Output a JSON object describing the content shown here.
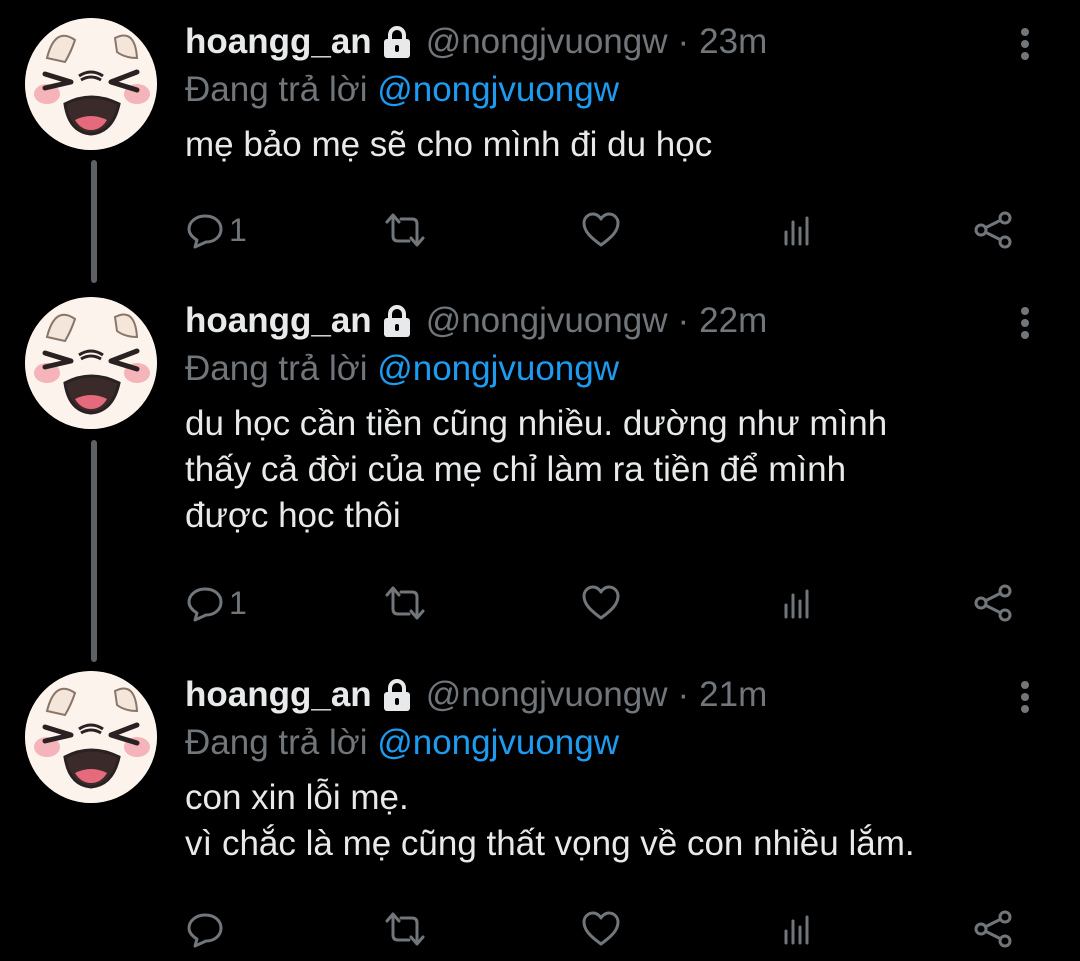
{
  "colors": {
    "background": "#000000",
    "text": "#e7e9ea",
    "muted": "#71767b",
    "mention": "#1d9bf0",
    "thread_line": "#5d6166"
  },
  "tweets": [
    {
      "display_name": "hoangg_an",
      "handle": "@nongjvuongw",
      "separator": "·",
      "time": "23m",
      "reply_prefix": "Đang trả lời",
      "reply_to": "@nongjvuongw",
      "lines": [
        "mẹ bảo mẹ sẽ cho mình đi du học"
      ],
      "reply_count": "1",
      "icons": {
        "lock": "lock-icon",
        "reply": "comment-icon",
        "retweet": "retweet-icon",
        "like": "heart-icon",
        "views": "analytics-icon",
        "share": "share-icon",
        "more": "more-vertical-icon"
      }
    },
    {
      "display_name": "hoangg_an",
      "handle": "@nongjvuongw",
      "separator": "·",
      "time": "22m",
      "reply_prefix": "Đang trả lời",
      "reply_to": "@nongjvuongw",
      "lines": [
        "du học cần tiền cũng nhiều. dường như mình",
        "thấy cả đời của mẹ chỉ làm ra tiền để mình",
        "được học thôi"
      ],
      "reply_count": "1"
    },
    {
      "display_name": "hoangg_an",
      "handle": "@nongjvuongw",
      "separator": "·",
      "time": "21m",
      "reply_prefix": "Đang trả lời",
      "reply_to": "@nongjvuongw",
      "lines": [
        "con xin lỗi mẹ.",
        "vì chắc là mẹ cũng thất vọng về con nhiều lắm."
      ],
      "reply_count": ""
    }
  ]
}
